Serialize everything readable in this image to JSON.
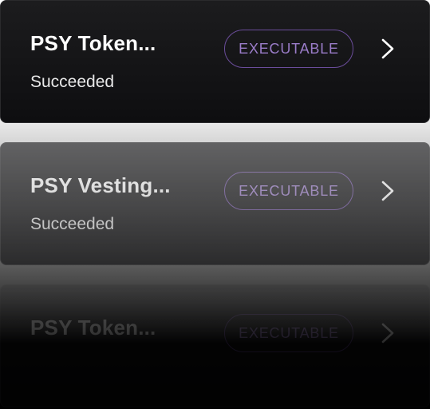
{
  "cards": [
    {
      "title": "PSY Token...",
      "status": "Succeeded",
      "badge": "EXECUTABLE",
      "action_icon": "chevron-right-icon"
    },
    {
      "title": "PSY Vesting...",
      "status": "Succeeded",
      "badge": "EXECUTABLE",
      "action_icon": "chevron-right-icon"
    },
    {
      "title": "PSY Token...",
      "status": "",
      "badge": "EXECUTABLE",
      "action_icon": "chevron-right-icon"
    }
  ],
  "colors": {
    "card_background": "#141416",
    "title_text": "#ffffff",
    "status_text": "#e9e9e9",
    "badge_border": "#6b4d9b",
    "badge_text": "#9a7cc8"
  }
}
